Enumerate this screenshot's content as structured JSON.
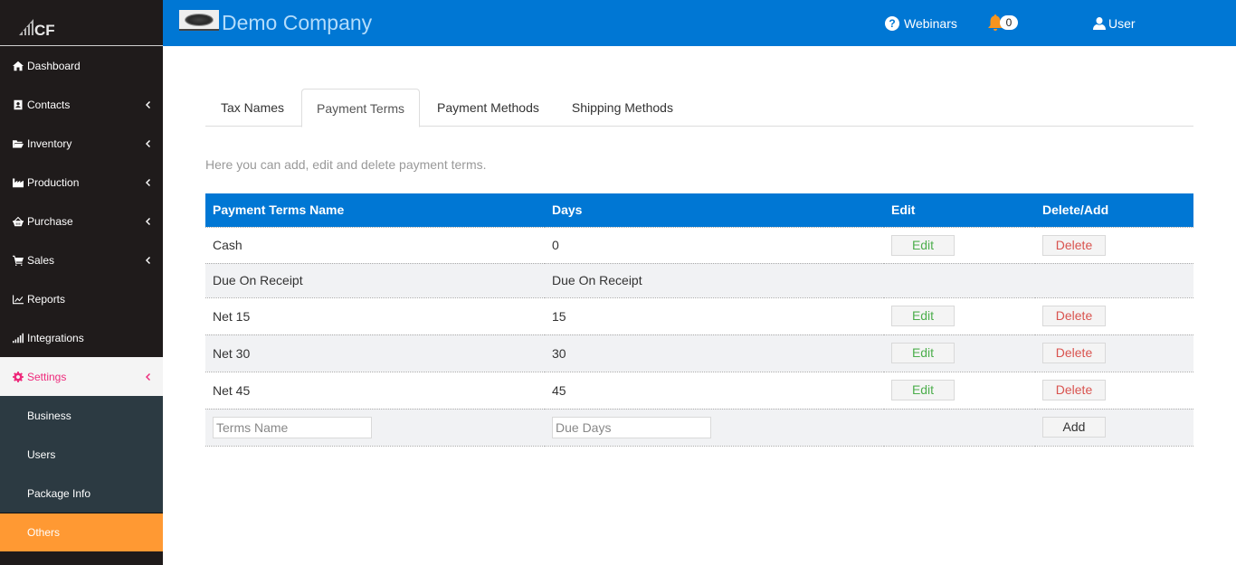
{
  "sidebar": {
    "logo_text": "CF",
    "items": [
      {
        "label": "Dashboard",
        "icon": "home-icon",
        "has_chevron": false
      },
      {
        "label": "Contacts",
        "icon": "contact-card-icon",
        "has_chevron": true
      },
      {
        "label": "Inventory",
        "icon": "folder-open-icon",
        "has_chevron": true
      },
      {
        "label": "Production",
        "icon": "industry-icon",
        "has_chevron": true
      },
      {
        "label": "Purchase",
        "icon": "basket-icon",
        "has_chevron": true
      },
      {
        "label": "Sales",
        "icon": "cart-icon",
        "has_chevron": true
      },
      {
        "label": "Reports",
        "icon": "line-chart-icon",
        "has_chevron": false
      },
      {
        "label": "Integrations",
        "icon": "signal-bars-icon",
        "has_chevron": false
      },
      {
        "label": "Settings",
        "icon": "gear-icon",
        "has_chevron": true,
        "active": true
      }
    ],
    "settings_submenu": [
      {
        "label": "Business"
      },
      {
        "label": "Users"
      },
      {
        "label": "Package Info"
      },
      {
        "label": "Others",
        "current": true
      }
    ]
  },
  "header": {
    "company_name": "Demo Company",
    "webinars_label": "Webinars",
    "notification_count": "0",
    "user_label": "User"
  },
  "main": {
    "tabs": [
      {
        "label": "Tax Names"
      },
      {
        "label": "Payment Terms",
        "active": true
      },
      {
        "label": "Payment Methods"
      },
      {
        "label": "Shipping Methods"
      }
    ],
    "description": "Here you can add, edit and delete payment terms.",
    "table": {
      "headers": [
        "Payment Terms Name",
        "Days",
        "Edit",
        "Delete/Add"
      ],
      "rows": [
        {
          "name": "Cash",
          "days": "0",
          "edit": "Edit",
          "delete": "Delete"
        },
        {
          "name": "Due On Receipt",
          "days": "Due On Receipt",
          "edit": "",
          "delete": ""
        },
        {
          "name": "Net 15",
          "days": "15",
          "edit": "Edit",
          "delete": "Delete"
        },
        {
          "name": "Net 30",
          "days": "30",
          "edit": "Edit",
          "delete": "Delete"
        },
        {
          "name": "Net 45",
          "days": "45",
          "edit": "Edit",
          "delete": "Delete"
        }
      ],
      "new_row": {
        "name_placeholder": "Terms Name",
        "name_value": "",
        "days_placeholder": "Due Days",
        "days_value": "",
        "add_label": "Add"
      }
    }
  },
  "colors": {
    "header_blue": "#0077d4",
    "sidebar_dark": "#1f1b1b",
    "submenu_dark": "#2c3a42",
    "active_pink": "#ee2a7b",
    "current_orange": "#ff9933",
    "edit_green": "#4cae4c",
    "delete_red": "#d9534f",
    "bell_orange": "#f7941d"
  }
}
